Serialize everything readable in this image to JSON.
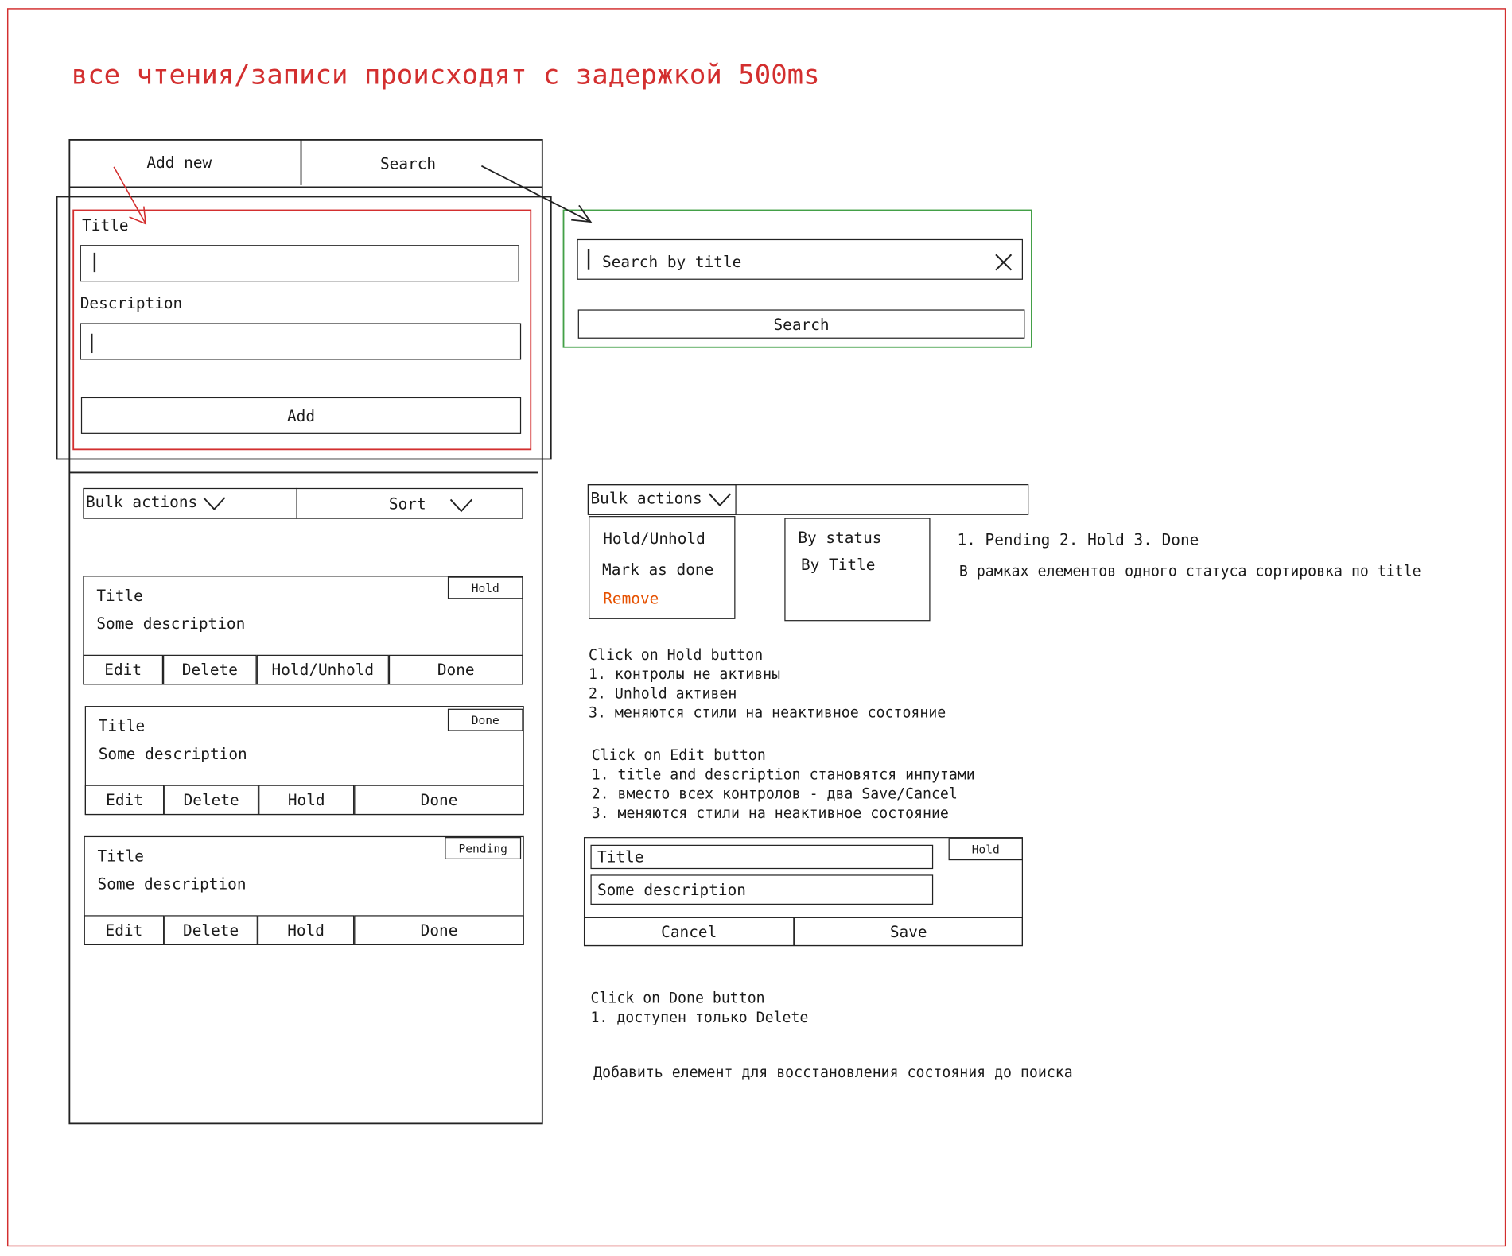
{
  "headline": "все чтения/записи происходят с задержкой 500ms",
  "colors": {
    "red": "#d32f2f",
    "green": "#43a047",
    "orange": "#e65100",
    "ink": "#222222"
  },
  "top_tabs": {
    "add_new": "Add new",
    "search": "Search"
  },
  "add_form": {
    "title_label": "Title",
    "description_label": "Description",
    "add_button": "Add"
  },
  "search_panel": {
    "placeholder": "Search by title",
    "clear_icon": "close-icon",
    "search_button": "Search"
  },
  "toolbar": {
    "bulk_actions": "Bulk actions",
    "sort": "Sort"
  },
  "cards": [
    {
      "title": "Title",
      "description": "Some description",
      "status": "Hold",
      "buttons": [
        "Edit",
        "Delete",
        "Hold/Unhold",
        "Done"
      ]
    },
    {
      "title": "Title",
      "description": "Some description",
      "status": "Done",
      "buttons": [
        "Edit",
        "Delete",
        "Hold",
        "Done"
      ]
    },
    {
      "title": "Title",
      "description": "Some description",
      "status": "Pending",
      "buttons": [
        "Edit",
        "Delete",
        "Hold",
        "Done"
      ]
    }
  ],
  "bulk_menu": {
    "label": "Bulk actions",
    "items": [
      "Hold/Unhold",
      "Mark as done",
      "Remove"
    ]
  },
  "sort_menu": {
    "items": [
      "By status",
      "By Title"
    ]
  },
  "sort_notes": [
    "1. Pending 2. Hold 3. Done",
    "В рамках елементов одного статуса сортировка по title"
  ],
  "hold_notes": "Click on Hold button\n1. контролы не активны\n2. Unhold активен\n3. меняются стили на неактивное состояние",
  "edit_notes": "Click on Edit button\n1. title and description становятся инпутами\n2. вместо всех контролов - два Save/Cancel\n3. меняются стили на неактивное состояние",
  "edit_card": {
    "title_value": "Title",
    "description_value": "Some description",
    "status": "Hold",
    "cancel": "Cancel",
    "save": "Save"
  },
  "done_notes": "Click on Done button\n1. доступен только Delete",
  "restore_note": "Добавить елемент для восстановления состояния до поиска"
}
